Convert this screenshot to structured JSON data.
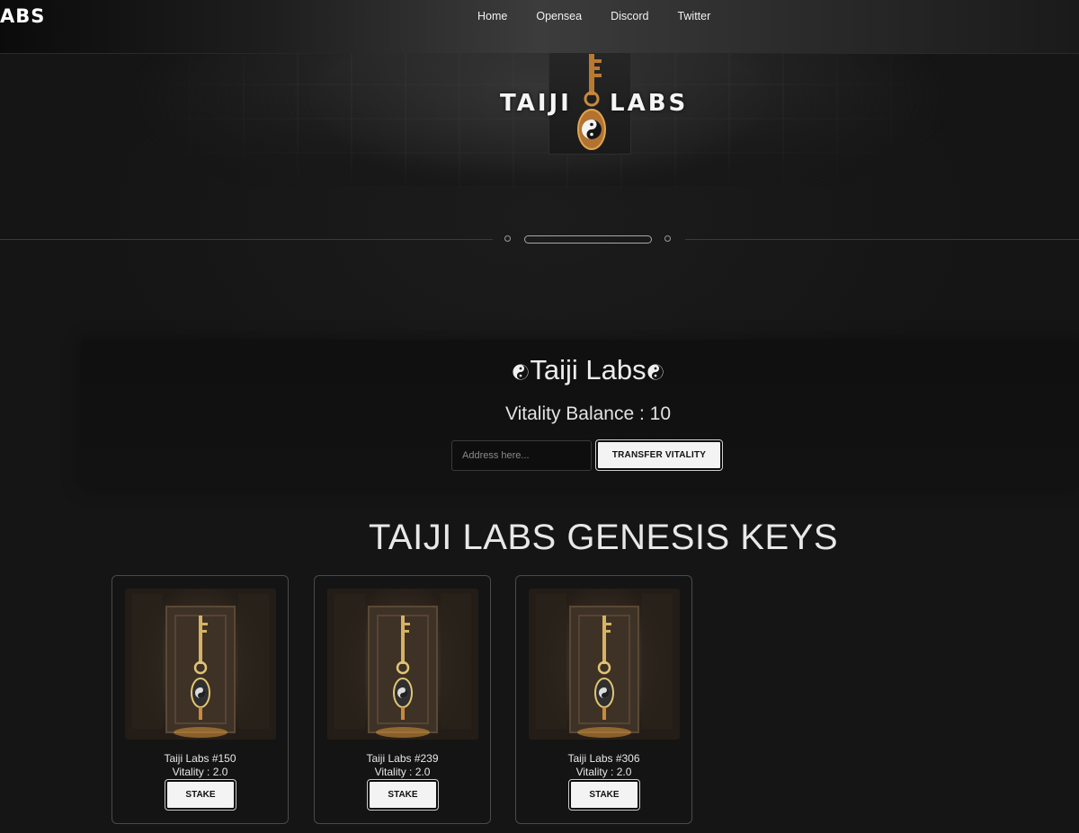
{
  "nav": {
    "logo_text": "ABS",
    "links": [
      "Home",
      "Opensea",
      "Discord",
      "Twitter"
    ]
  },
  "hero": {
    "logo_left": "TAIJI",
    "logo_right": "LABS"
  },
  "panel": {
    "title": "Taiji Labs",
    "balance_text": "Vitality Balance : 10",
    "address_placeholder": "Address here...",
    "transfer_label": "TRANSFER VITALITY"
  },
  "section": {
    "title": "TAIJI LABS GENESIS KEYS"
  },
  "cards": [
    {
      "name": "Taiji Labs #150",
      "vitality": "Vitality : 2.0",
      "stake_label": "STAKE"
    },
    {
      "name": "Taiji Labs #239",
      "vitality": "Vitality : 2.0",
      "stake_label": "STAKE"
    },
    {
      "name": "Taiji Labs #306",
      "vitality": "Vitality : 2.0",
      "stake_label": "STAKE"
    }
  ],
  "colors": {
    "background": "#161616",
    "panel": "#111111",
    "key_gold": "#c98a3c",
    "button_bg": "#f3f3f3"
  }
}
